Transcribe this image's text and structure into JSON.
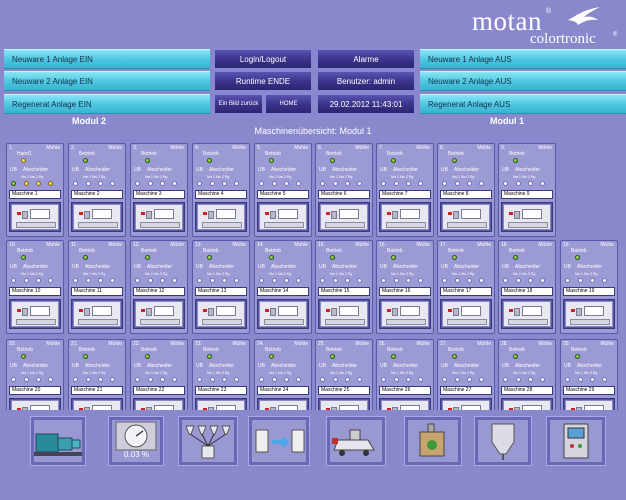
{
  "brand": {
    "name": "motan",
    "registered": "®",
    "sub": "colortronic",
    "sub_registered": "®"
  },
  "buttons": {
    "left": [
      "Neuware 1 Anlage EIN",
      "Neuware 2 Anlage EIN",
      "Regenerat Anlage EIN"
    ],
    "right": [
      "Neuware 1 Anlage AUS",
      "Neuware 2 Anlage AUS",
      "Regenerat Anlage AUS"
    ],
    "login": "Login/Logout",
    "alarme": "Alarme",
    "runtime": "Runtime ENDE",
    "benutzer": "Benutzer: admin",
    "back": "Ein Bild zurück",
    "home": "HOME",
    "datetime": "29.02.2012 11:43:01"
  },
  "labels": {
    "modul2": "Modul 2",
    "modul1": "Modul 1",
    "overview": "Maschinenübersicht:   Modul 1"
  },
  "card_text": {
    "muehle": "Mühle",
    "betrieb": "Betrieb",
    "hand": "Hand1",
    "ub": "UB",
    "abscheider": "Abscheider",
    "sub": "Nw 1   Nw 2    Rg"
  },
  "machines": [
    {
      "n": "1.",
      "name": "Maschine 1"
    },
    {
      "n": "2.",
      "name": "Maschine 2"
    },
    {
      "n": "3.",
      "name": "Maschine 3"
    },
    {
      "n": "4.",
      "name": "Maschine 4"
    },
    {
      "n": "5.",
      "name": "Maschine 5"
    },
    {
      "n": "6.",
      "name": "Maschine 6"
    },
    {
      "n": "7.",
      "name": "Maschine 7"
    },
    {
      "n": "8.",
      "name": "Maschine 8"
    },
    {
      "n": "9.",
      "name": "Maschine 9"
    },
    {
      "n": "10.",
      "name": "Maschine 10"
    },
    {
      "n": "11.",
      "name": "Maschine 11"
    },
    {
      "n": "12.",
      "name": "Maschine 12"
    },
    {
      "n": "13.",
      "name": "Maschine 13"
    },
    {
      "n": "14.",
      "name": "Maschine 14"
    },
    {
      "n": "15.",
      "name": "Maschine 15"
    },
    {
      "n": "16.",
      "name": "Maschine 16"
    },
    {
      "n": "17.",
      "name": "Maschine 17"
    },
    {
      "n": "18.",
      "name": "Maschine 18"
    },
    {
      "n": "19.",
      "name": "Maschine 19"
    },
    {
      "n": "20.",
      "name": "Maschine 20"
    },
    {
      "n": "21.",
      "name": "Maschine 21"
    },
    {
      "n": "22.",
      "name": "Maschine 22"
    },
    {
      "n": "23.",
      "name": "Maschine 23"
    },
    {
      "n": "24.",
      "name": "Maschine 24"
    },
    {
      "n": "25.",
      "name": "Maschine 25"
    },
    {
      "n": "26.",
      "name": "Maschine 26"
    },
    {
      "n": "27.",
      "name": "Maschine 27"
    },
    {
      "n": "28.",
      "name": "Maschine 28"
    },
    {
      "n": "29.",
      "name": "Maschine 29"
    }
  ],
  "gauge": {
    "value": "0.03",
    "unit": "%"
  },
  "tiles": [
    "pump-unit-icon",
    "gauge-icon",
    "hopper-array-icon",
    "material-transfer-icon",
    "granulator-icon",
    "dryer-box-icon",
    "silo-icon",
    "control-cabinet-icon"
  ],
  "colors": {
    "background": "#8a88cc",
    "button_cyan": "#4cc6e0",
    "button_dark": "#3a3288",
    "led_green": "#3c9c18",
    "led_yellow": "#e0b414"
  }
}
